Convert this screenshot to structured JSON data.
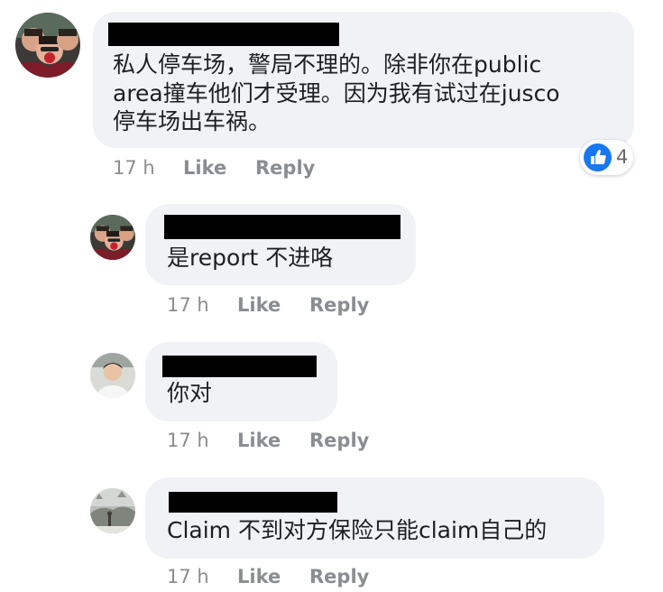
{
  "comments": [
    {
      "author_redacted": true,
      "text_lines": [
        "私人停车场，警局不理的。除非你在public",
        "area撞车他们才受理。因为我有试过在jusco",
        "停车场出车祸。"
      ],
      "time": "17 h",
      "like_label": "Like",
      "reply_label": "Reply",
      "reaction": {
        "icon": "thumbs-up-icon",
        "count": "4",
        "color": "#1877f2"
      }
    },
    {
      "author_redacted": true,
      "text_lines": [
        "是report 不进咯"
      ],
      "time": "17 h",
      "like_label": "Like",
      "reply_label": "Reply"
    },
    {
      "author_redacted": true,
      "text_lines": [
        "你对"
      ],
      "time": "17 h",
      "like_label": "Like",
      "reply_label": "Reply"
    },
    {
      "author_redacted": true,
      "text_lines": [
        "Claim 不到对方保险只能claim自己的"
      ],
      "time": "17 h",
      "like_label": "Like",
      "reply_label": "Reply"
    }
  ],
  "colors": {
    "bubble": "#f0f2f5",
    "meta_text": "#8a8d91",
    "like_blue": "#1877f2"
  }
}
